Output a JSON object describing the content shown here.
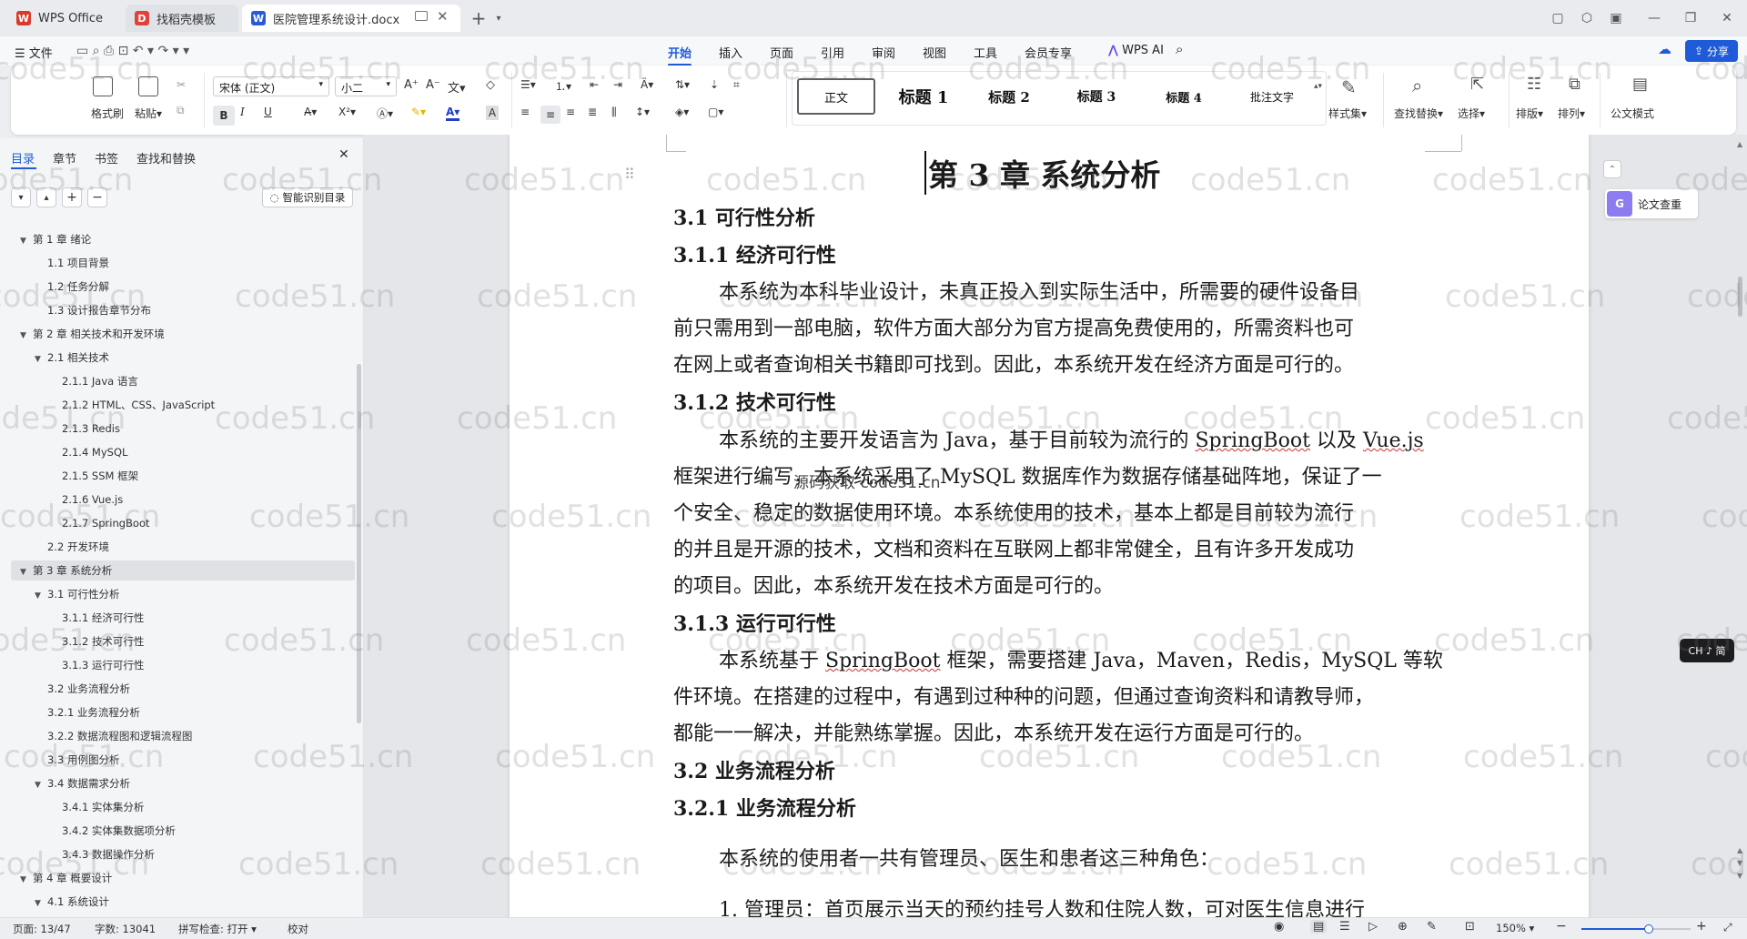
{
  "titlebar": {
    "tabs": [
      {
        "label": "WPS Office",
        "icon": "wps-logo-icon"
      },
      {
        "label": "找稻壳模板",
        "icon": "docer-icon"
      },
      {
        "label": "医院管理系统设计.docx",
        "icon": "word-doc-icon"
      }
    ],
    "new_tab": "+"
  },
  "menubar": {
    "file": "文件",
    "tabs": [
      "开始",
      "插入",
      "页面",
      "引用",
      "审阅",
      "视图",
      "工具",
      "会员专享"
    ],
    "active_tab": "开始",
    "wps_ai": "WPS AI",
    "share": "分享"
  },
  "ribbon": {
    "format_painter": "格式刷",
    "paste": "粘贴",
    "font_name": "宋体 (正文)",
    "font_size": "小二",
    "styles": [
      "正文",
      "标题 1",
      "标题 2",
      "标题 3",
      "标题 4",
      "批注文字"
    ],
    "style_set": "样式集",
    "find_replace": "查找替换",
    "select": "选择",
    "layout": "排版",
    "arrange": "排列",
    "official_mode": "公文模式",
    "bold": "B",
    "italic": "I",
    "underline": "U"
  },
  "sidebar": {
    "tabs": [
      "目录",
      "章节",
      "书签",
      "查找和替换"
    ],
    "smart_toc": "智能识别目录",
    "toc": [
      {
        "label": "第 1 章  绪论",
        "level": 1,
        "expanded": true
      },
      {
        "label": "1.1  项目背景",
        "level": 2
      },
      {
        "label": "1.2  任务分解",
        "level": 2
      },
      {
        "label": "1.3  设计报告章节分布",
        "level": 2
      },
      {
        "label": "第 2 章  相关技术和开发环境",
        "level": 1,
        "expanded": true
      },
      {
        "label": "2.1  相关技术",
        "level": 2,
        "expanded": true
      },
      {
        "label": "2.1.1 Java 语言",
        "level": 3
      },
      {
        "label": "2.1.2 HTML、CSS、JavaScript",
        "level": 3
      },
      {
        "label": "2.1.3 Redis",
        "level": 3
      },
      {
        "label": "2.1.4 MySQL",
        "level": 3
      },
      {
        "label": "2.1.5 SSM 框架",
        "level": 3
      },
      {
        "label": "2.1.6 Vue.js",
        "level": 3
      },
      {
        "label": "2.1.7 SpringBoot",
        "level": 3
      },
      {
        "label": "2.2  开发环境",
        "level": 2
      },
      {
        "label": "第 3 章  系统分析",
        "level": 1,
        "expanded": true,
        "selected": true
      },
      {
        "label": "3.1  可行性分析",
        "level": 2,
        "expanded": true
      },
      {
        "label": "3.1.1  经济可行性",
        "level": 3
      },
      {
        "label": "3.1.2  技术可行性",
        "level": 3
      },
      {
        "label": "3.1.3  运行可行性",
        "level": 3
      },
      {
        "label": "3.2  业务流程分析",
        "level": 2
      },
      {
        "label": "3.2.1  业务流程分析",
        "level": 2
      },
      {
        "label": "3.2.2  数据流程图和逻辑流程图",
        "level": 2
      },
      {
        "label": "3.3  用例图分析",
        "level": 2
      },
      {
        "label": "3.4  数据需求分析",
        "level": 2,
        "expanded": true
      },
      {
        "label": "3.4.1  实体集分析",
        "level": 3
      },
      {
        "label": "3.4.2  实体集数据项分析",
        "level": 3
      },
      {
        "label": "3.4.3  数据操作分析",
        "level": 3
      },
      {
        "label": "第 4 章  概要设计",
        "level": 1,
        "expanded": true
      },
      {
        "label": "4.1  系统设计",
        "level": 2,
        "expanded": true
      }
    ]
  },
  "document": {
    "chapter_title": "第 3 章  系统分析",
    "h_3_1": "3.1  可行性分析",
    "h_3_1_1": "3.1.1  经济可行性",
    "p_econ": [
      "本系统为本科毕业设计，未真正投入到实际生活中，所需要的硬件设备目",
      "前只需用到一部电脑，软件方面大部分为官方提高免费使用的，所需资料也可",
      "在网上或者查询相关书籍即可找到。因此，本系统开发在经济方面是可行的。"
    ],
    "h_3_1_2": "3.1.2  技术可行性",
    "p_tech_1a": "本系统的主要开发语言为 Java，基于目前较为流行的 ",
    "p_tech_1b": "SpringBoot",
    "p_tech_1c": " 以及 ",
    "p_tech_1d": "Vue.js",
    "p_tech_2a": "框架进行编写，本系统采用了 MySQL 数据库作为数据存储基础阵地，保证了一",
    "p_tech_rest": [
      "个安全、稳定的数据使用环境。本系统使用的技术，基本上都是目前较为流行",
      "的并且是开源的技术，文档和资料在互联网上都非常健全，且有许多开发成功",
      "的项目。因此，本系统开发在技术方面是可行的。"
    ],
    "overlay_text": "源码获取 code51.cn",
    "h_3_1_3": "3.1.3  运行可行性",
    "p_run_1a": "本系统基于 ",
    "p_run_1b": "SpringBoot",
    "p_run_1c": " 框架，需要搭建 Java，Maven，Redis，MySQL 等软",
    "p_run_rest": [
      "件环境。在搭建的过程中，有遇到过种种的问题，但通过查询资料和请教导师，",
      "都能一一解决，并能熟练掌握。因此，本系统开发在运行方面是可行的。"
    ],
    "h_3_2": "3.2  业务流程分析",
    "h_3_2_1": "3.2.1  业务流程分析",
    "p_roles": "本系统的使用者一共有管理员、医生和患者这三种角色：",
    "p_admin": "1.  管理员：首页展示当天的预约挂号人数和住院人数，可对医生信息进行"
  },
  "right_panel": {
    "paper_check": "论文查重",
    "ime": "CH ♪ 简"
  },
  "watermark": "code51.cn",
  "statusbar": {
    "page": "页面: 13/47",
    "words": "字数: 13041",
    "spell": "拼写检查: 打开",
    "proof": "校对",
    "zoom": "150%",
    "zoom_fraction": 0.62
  },
  "colors": {
    "accent": "#1f5bd8",
    "wps_red": "#d93a2b",
    "docer_red": "#e0413a",
    "word_blue": "#2a5bd7"
  }
}
